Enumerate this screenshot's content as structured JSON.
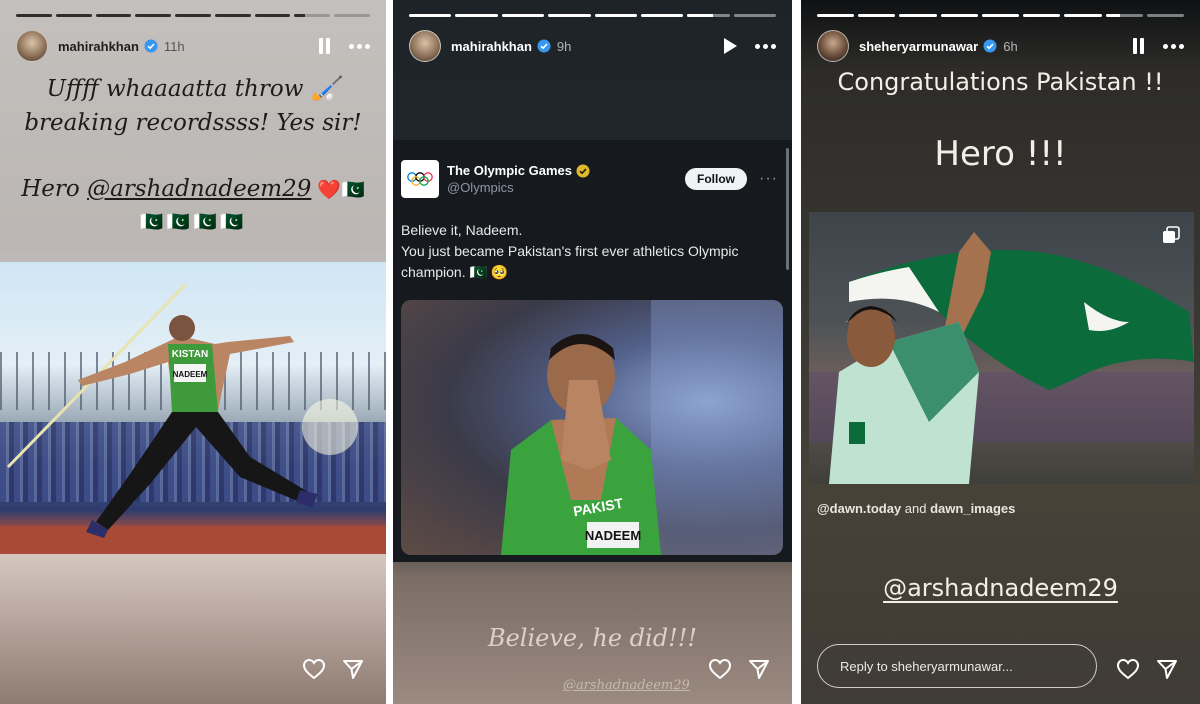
{
  "stories": [
    {
      "username": "mahirahkhan",
      "time": "11h",
      "progress": [
        1,
        1,
        1,
        1,
        1,
        1,
        1,
        0.3,
        0
      ],
      "text_line1": "Uffff whaaaatta throw 🏑",
      "text_line2": "breaking recordssss! Yes sir!",
      "hero_prefix": "Hero ",
      "hero_mention": "@arshadnadeem29",
      "hero_suffix": " ❤️🇵🇰",
      "flags": "🇵🇰🇵🇰🇵🇰🇵🇰",
      "jersey_text": "KISTAN",
      "bib_text": "NADEEM"
    },
    {
      "username": "mahirahkhan",
      "time": "9h",
      "progress": [
        1,
        1,
        1,
        1,
        1,
        1,
        0.6,
        0
      ],
      "tweet": {
        "name": "The Olympic Games",
        "handle": "@Olympics",
        "follow": "Follow",
        "line1": "Believe it, Nadeem.",
        "line2": "You just became Pakistan's first ever athletics Olympic champion. 🇵🇰 🥺",
        "jersey_text": "PAKIST",
        "bib_text": "NADEEM"
      },
      "caption": "Believe, he did!!!",
      "mention": "@arshadnadeem29"
    },
    {
      "username": "sheheryarmunawar",
      "time": "6h",
      "progress": [
        1,
        1,
        1,
        1,
        1,
        1,
        1,
        0.4,
        0
      ],
      "title": "Congratulations Pakistan !!",
      "hero": "Hero !!!",
      "credit_a": "@dawn.today",
      "credit_and": " and ",
      "credit_b": "dawn_images",
      "mention": "@arshadnadeem29",
      "reply_placeholder": "Reply to sheheryarmunawar..."
    }
  ],
  "colors": {
    "pakistan_green": "#0b6b3a",
    "jersey_green": "#3f9a3c",
    "track_red": "#a84a36",
    "verified_blue": "#3897f0",
    "x_gold": "#e0b92a"
  }
}
